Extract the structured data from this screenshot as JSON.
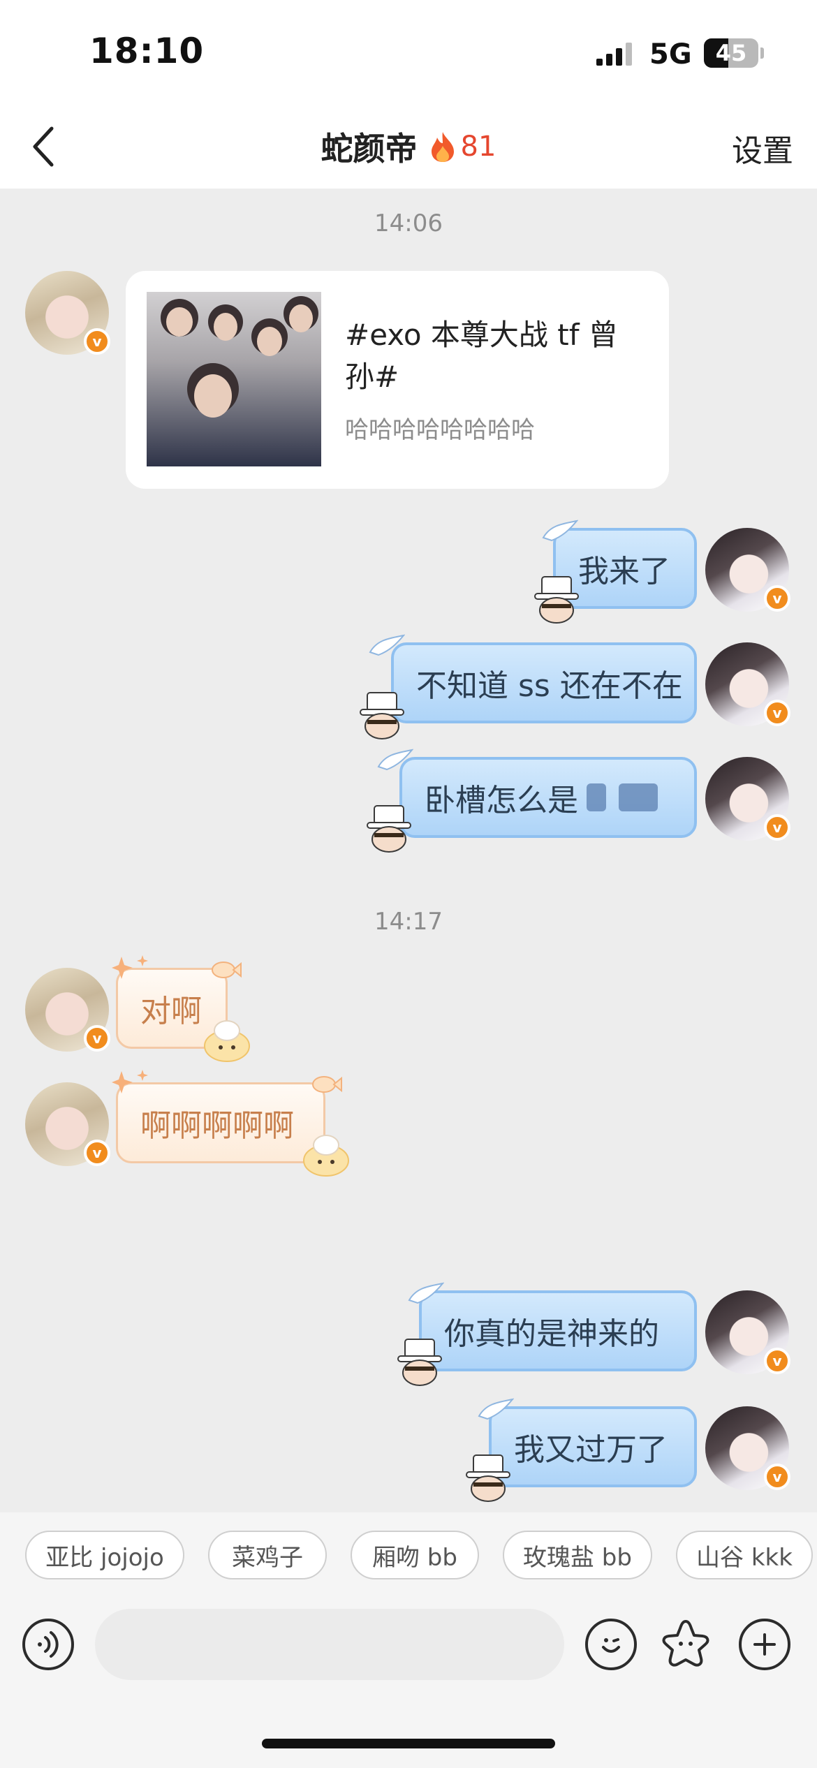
{
  "status": {
    "time": "18:10",
    "network": "5G",
    "battery": "45",
    "battery_level": 0.45
  },
  "nav": {
    "title": "蛇颜帝",
    "streak": "81",
    "settings_label": "设置",
    "back_icon": "chevron-left-icon",
    "streak_icon": "flame-icon"
  },
  "messages": [
    {
      "type": "time",
      "text": "14:06"
    },
    {
      "type": "card",
      "side": "left",
      "title": "#exo 本尊大战 tf 曾孙#",
      "subtitle": "哈哈哈哈哈哈哈哈"
    },
    {
      "type": "text",
      "side": "right",
      "text": "我来了"
    },
    {
      "type": "text",
      "side": "right",
      "text": "不知道 ss 还在不在"
    },
    {
      "type": "text",
      "side": "right",
      "text": "卧槽怎么是"
    },
    {
      "type": "time",
      "text": "14:17"
    },
    {
      "type": "text",
      "side": "left",
      "text": "对啊"
    },
    {
      "type": "text",
      "side": "left",
      "text": "啊啊啊啊啊"
    },
    {
      "type": "text",
      "side": "right",
      "text": "你真的是神来的"
    },
    {
      "type": "text",
      "side": "right",
      "text": "我又过万了"
    }
  ],
  "quick_replies": [
    "亚比 jojojo",
    "菜鸡子",
    "厢吻 bb",
    "玫瑰盐 bb",
    "山谷 kkk"
  ],
  "input": {
    "placeholder": "",
    "voice_icon": "voice-icon",
    "emoji_icon": "emoji-icon",
    "sticker_icon": "sticker-star-icon",
    "plus_icon": "plus-icon"
  },
  "colors": {
    "accent": "#f18c1d",
    "streak": "#e5462e",
    "bubble_right": "#aed4f8",
    "bubble_left": "#fdebd9"
  }
}
